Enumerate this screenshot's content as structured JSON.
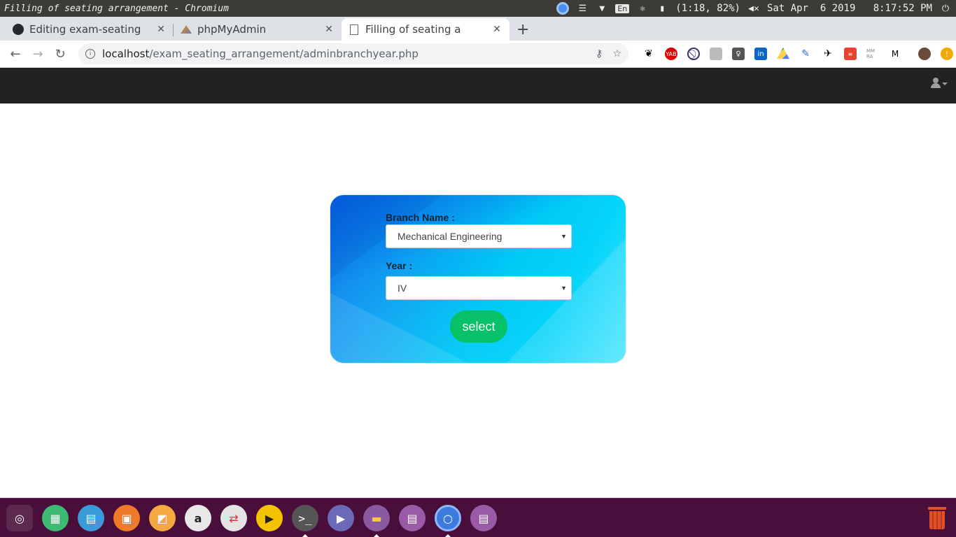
{
  "system_bar": {
    "window_title": "Filling of seating arrangement - Chromium",
    "language": "En",
    "battery": "(1:18, 82%)",
    "datetime": "Sat Apr  6 2019   8:17:52 PM"
  },
  "tabs": [
    {
      "title": "Editing exam-seating",
      "icon": "github-icon",
      "active": false
    },
    {
      "title": "phpMyAdmin",
      "icon": "phpmyadmin-icon",
      "active": false
    },
    {
      "title": "Filling of seating a",
      "icon": "page-icon",
      "active": true
    }
  ],
  "address_bar": {
    "host": "localhost",
    "path": "/exam_seating_arrangement/adminbranchyear.php"
  },
  "form": {
    "branch_label": "Branch Name :",
    "branch_value": "Mechanical Engineering",
    "year_label": "Year :",
    "year_value": "IV",
    "submit_label": "select"
  },
  "colors": {
    "navbar": "#222222",
    "button": "#06c167",
    "card_start": "#0a6ee8",
    "card_end": "#4ee6fd",
    "dock": "#4a0e3a"
  }
}
